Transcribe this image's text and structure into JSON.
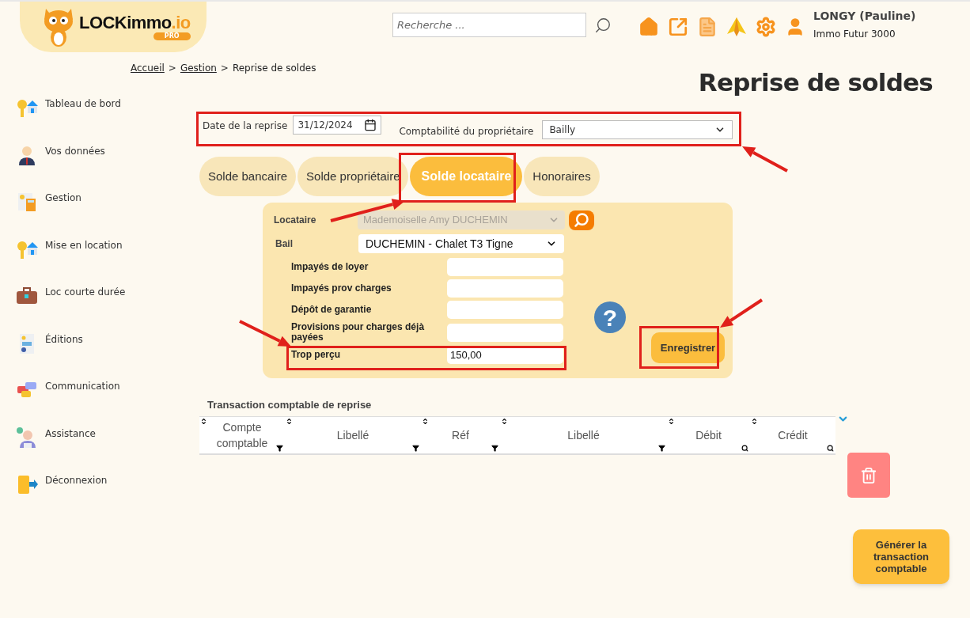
{
  "header": {
    "logo": {
      "text": "LOCKimmo",
      "suffix": ".io",
      "badge": "PRO"
    },
    "search": {
      "placeholder": "Recherche ..."
    },
    "user": {
      "name": "LONGY (Pauline)",
      "company": "Immo Futur 3000"
    }
  },
  "breadcrumb": [
    {
      "label": "Accueil",
      "link": true,
      "separator": ">"
    },
    {
      "label": "Gestion",
      "link": true,
      "separator": ">"
    },
    {
      "label": "Reprise de soldes",
      "link": false
    }
  ],
  "page_title": "Reprise de soldes",
  "sidebar": {
    "items": [
      {
        "label": "Tableau de bord"
      },
      {
        "label": "Vos données"
      },
      {
        "label": "Gestion"
      },
      {
        "label": "Mise en location"
      },
      {
        "label": "Loc courte durée"
      },
      {
        "label": "Éditions"
      },
      {
        "label": "Communication"
      },
      {
        "label": "Assistance"
      },
      {
        "label": "Déconnexion"
      }
    ]
  },
  "filters": {
    "date": {
      "label": "Date de la reprise",
      "value": "31/12/2024"
    },
    "owner_accounting": {
      "label": "Comptabilité du propriétaire",
      "value": "Bailly"
    }
  },
  "tabs": [
    {
      "label": "Solde bancaire",
      "selected": false
    },
    {
      "label": "Solde propriétaire",
      "selected": false
    },
    {
      "label": "Solde locataire",
      "selected": true
    },
    {
      "label": "Honoraires",
      "selected": false
    }
  ],
  "form": {
    "tenant": {
      "label": "Locataire",
      "value": "Mademoiselle Amy DUCHEMIN",
      "disabled": true
    },
    "lease": {
      "label": "Bail",
      "value": "DUCHEMIN - Chalet T3 Tigne",
      "disabled": false
    },
    "fields": [
      {
        "label": "Impayés de loyer"
      },
      {
        "label": "Impayés prov charges"
      },
      {
        "label": "Dépôt de garantie"
      },
      {
        "label": "Provisions pour charges déjà payées"
      },
      {
        "label": "Trop perçu",
        "value": "150,00"
      }
    ],
    "help": "?",
    "save_button": "Enregistrer"
  },
  "table": {
    "title": "Transaction comptable de reprise",
    "columns": [
      {
        "label": "Compte comptable",
        "kind": "funnel"
      },
      {
        "label": "Libellé",
        "kind": "funnel"
      },
      {
        "label": "Réf",
        "kind": "funnel"
      },
      {
        "label": "Libellé",
        "kind": "funnel"
      },
      {
        "label": "Débit",
        "kind": "search"
      },
      {
        "label": "Crédit",
        "kind": "search"
      }
    ]
  },
  "generate_button": "Générer la transaction comptable"
}
